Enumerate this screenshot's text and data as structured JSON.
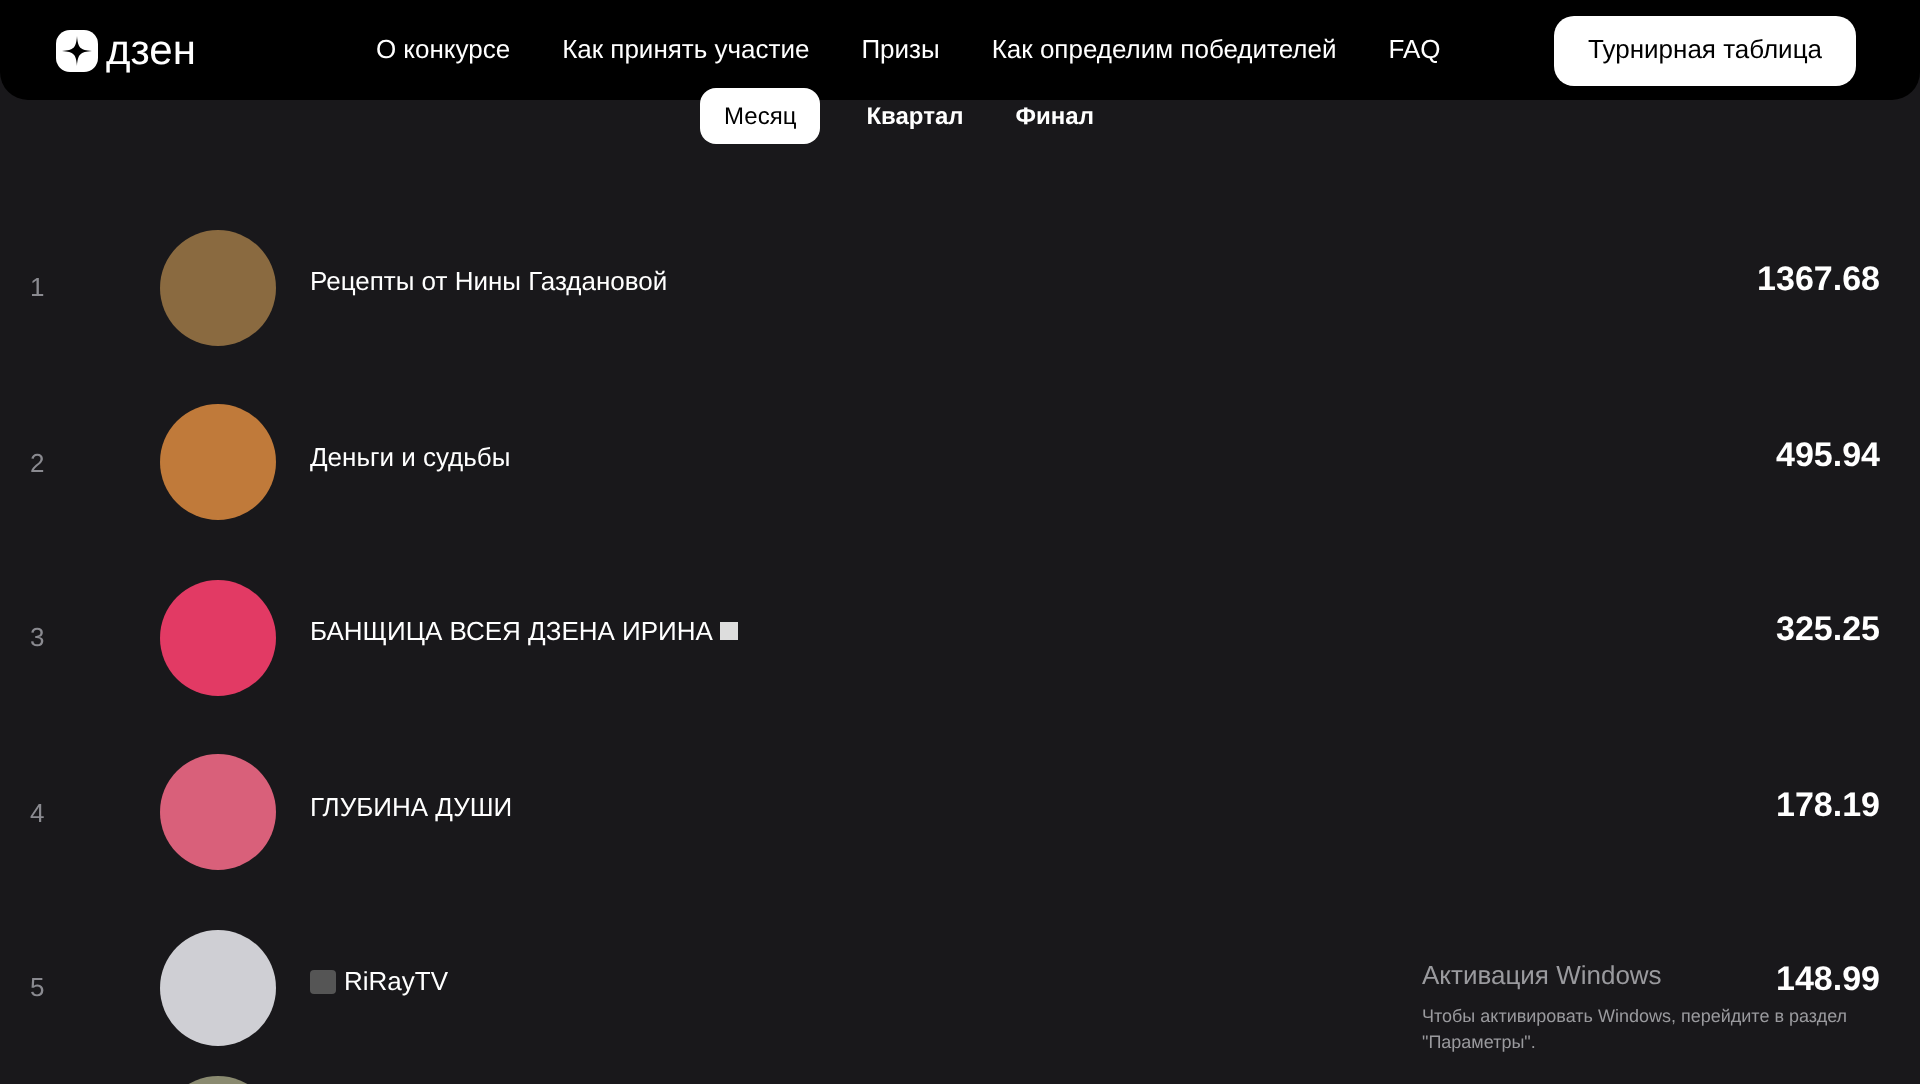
{
  "header": {
    "logo": "дзен",
    "nav": [
      "О конкурсе",
      "Как принять участие",
      "Призы",
      "Как определим победителей",
      "FAQ"
    ],
    "cta": "Турнирная таблица"
  },
  "tabs": [
    {
      "label": "Месяц",
      "selected": true
    },
    {
      "label": "Квартал",
      "selected": false
    },
    {
      "label": "Финал",
      "selected": false
    }
  ],
  "rows": [
    {
      "rank": "1",
      "name": "Рецепты от Нины Газдановой",
      "score": "1367.68"
    },
    {
      "rank": "2",
      "name": "Деньги и судьбы",
      "score": "495.94"
    },
    {
      "rank": "3",
      "name": "БАНЩИЦА ВСЕЯ ДЗЕНА ИРИНА",
      "badge": true,
      "score": "325.25"
    },
    {
      "rank": "4",
      "name": "ГЛУБИНА ДУШИ",
      "score": "178.19"
    },
    {
      "rank": "5",
      "name": "RiRayTV",
      "camera": true,
      "score": "148.99"
    }
  ],
  "windows_notice": {
    "title": "Активация Windows",
    "text": "Чтобы активировать Windows, перейдите в раздел \"Параметры\"."
  }
}
